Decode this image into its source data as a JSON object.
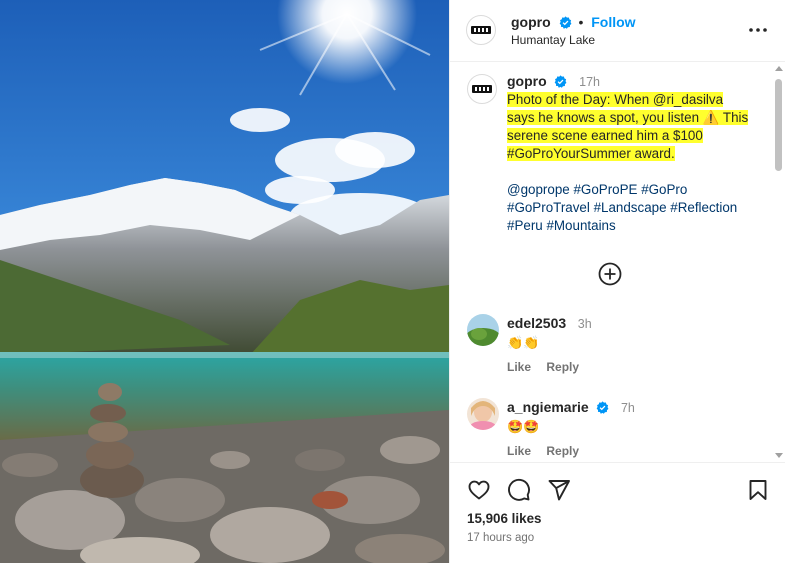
{
  "post": {
    "username": "gopro",
    "follow_label": "Follow",
    "location": "Humantay Lake",
    "more_icon": "more-options-icon",
    "separator": "•"
  },
  "caption": {
    "username": "gopro",
    "time": "17h",
    "line1": "Photo of the Day: When @ri_dasilva",
    "line2": "says he knows a spot, you listen ⚠️ This",
    "line3": "serene scene earned him a $100",
    "line4": "#GoProYourSummer award.",
    "tags1": "@goprope #GoProPE #GoPro",
    "tags2": "#GoProTravel #Landscape #Reflection",
    "tags3": "#Peru #Mountains"
  },
  "comments": [
    {
      "username": "edel2503",
      "time": "3h",
      "emojis": "👏👏",
      "like": "Like",
      "reply": "Reply"
    },
    {
      "username": "a_ngiemarie",
      "time": "7h",
      "emojis": "🤩🤩",
      "like": "Like",
      "reply": "Reply"
    }
  ],
  "footer": {
    "likes": "15,906 likes",
    "ago": "17 hours ago"
  },
  "colors": {
    "accent": "#0095f6",
    "highlight": "#ffff2e",
    "hashtag": "#00376b",
    "muted": "#737373"
  }
}
